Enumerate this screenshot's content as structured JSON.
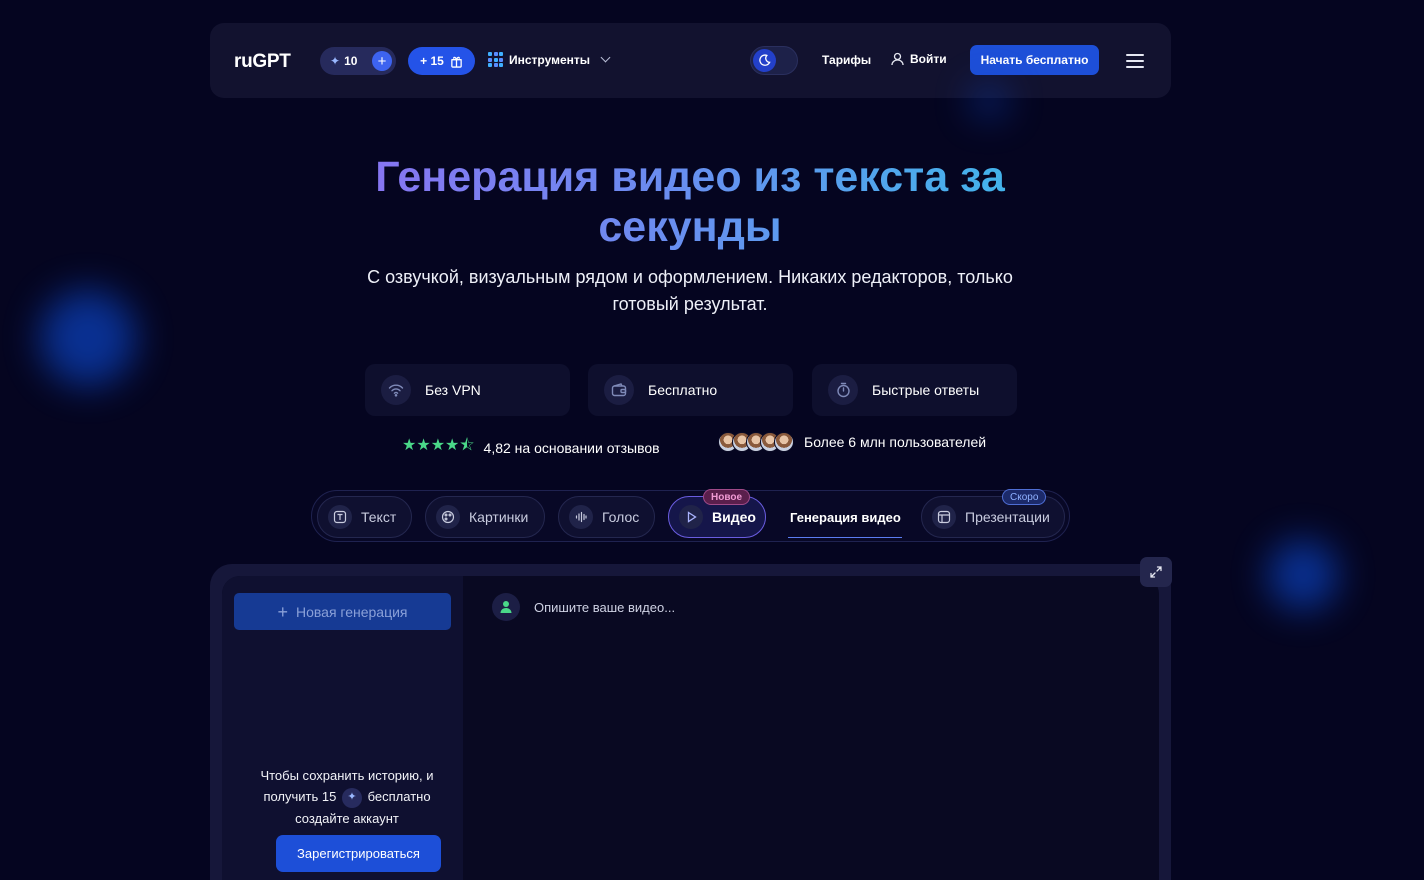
{
  "header": {
    "logo": "ruGPT",
    "credits": "10",
    "bonus": "+ 15",
    "tools_label": "Инструменты",
    "tariffs_label": "Тарифы",
    "login_label": "Войти",
    "start_label": "Начать бесплатно"
  },
  "hero": {
    "title": "Генерация видео из текста за секунды",
    "subtitle": "С озвучкой, визуальным рядом и оформлением. Никаких редакторов, только готовый результат."
  },
  "features": [
    {
      "label": "Без VPN",
      "icon": "wifi-icon"
    },
    {
      "label": "Бесплатно",
      "icon": "wallet-icon"
    },
    {
      "label": "Быстрые ответы",
      "icon": "stopwatch-icon"
    }
  ],
  "rating": {
    "stars": 4.5,
    "text": "4,82 на основании отзывов"
  },
  "users": {
    "text": "Более 6 млн пользователей"
  },
  "tabs": [
    {
      "label": "Текст"
    },
    {
      "label": "Картинки"
    },
    {
      "label": "Голос"
    },
    {
      "label": "Видео",
      "badge": "Новое",
      "active": true
    },
    {
      "label": "Генерация видео"
    },
    {
      "label": "Презентации",
      "badge": "Скоро"
    }
  ],
  "workspace": {
    "new_generation_label": "Новая генерация",
    "save_note_part1": "Чтобы сохранить историю, и получить 15",
    "save_note_part2": "бесплатно создайте аккаунт",
    "register_label": "Зарегистрироваться",
    "prompt_placeholder": "Опишите ваше видео..."
  },
  "colors": {
    "background": "#050520",
    "accent": "#1d4fd8",
    "star": "#4ad889"
  }
}
